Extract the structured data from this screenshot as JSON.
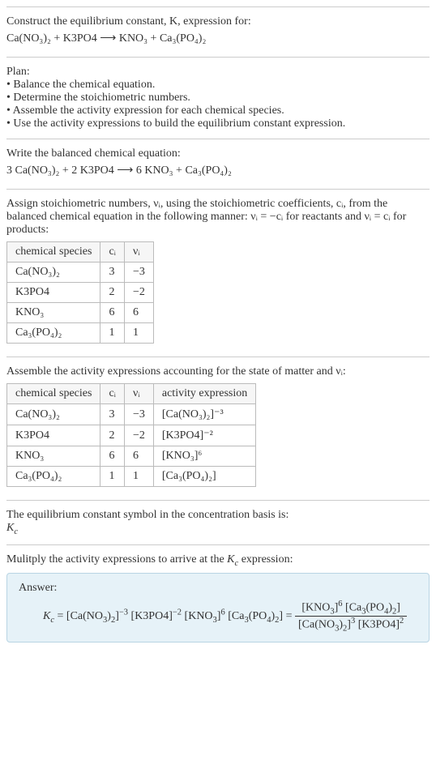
{
  "intro": {
    "line1": "Construct the equilibrium constant, K, expression for:",
    "equation": "Ca(NO₃)₂ + K3PO4 ⟶ KNO₃ + Ca₃(PO₄)₂"
  },
  "plan": {
    "heading": "Plan:",
    "items": [
      "• Balance the chemical equation.",
      "• Determine the stoichiometric numbers.",
      "• Assemble the activity expression for each chemical species.",
      "• Use the activity expressions to build the equilibrium constant expression."
    ]
  },
  "balanced": {
    "heading": "Write the balanced chemical equation:",
    "equation": "3 Ca(NO₃)₂ + 2 K3PO4 ⟶ 6 KNO₃ + Ca₃(PO₄)₂"
  },
  "stoich": {
    "text": "Assign stoichiometric numbers, νᵢ, using the stoichiometric coefficients, cᵢ, from the balanced chemical equation in the following manner: νᵢ = −cᵢ for reactants and νᵢ = cᵢ for products:",
    "headers": [
      "chemical species",
      "cᵢ",
      "νᵢ"
    ],
    "rows": [
      [
        "Ca(NO₃)₂",
        "3",
        "−3"
      ],
      [
        "K3PO4",
        "2",
        "−2"
      ],
      [
        "KNO₃",
        "6",
        "6"
      ],
      [
        "Ca₃(PO₄)₂",
        "1",
        "1"
      ]
    ]
  },
  "activity": {
    "heading": "Assemble the activity expressions accounting for the state of matter and νᵢ:",
    "headers": [
      "chemical species",
      "cᵢ",
      "νᵢ",
      "activity expression"
    ],
    "rows": [
      [
        "Ca(NO₃)₂",
        "3",
        "−3",
        "[Ca(NO₃)₂]⁻³"
      ],
      [
        "K3PO4",
        "2",
        "−2",
        "[K3PO4]⁻²"
      ],
      [
        "KNO₃",
        "6",
        "6",
        "[KNO₃]⁶"
      ],
      [
        "Ca₃(PO₄)₂",
        "1",
        "1",
        "[Ca₃(PO₄)₂]"
      ]
    ]
  },
  "symbol": {
    "line1": "The equilibrium constant symbol in the concentration basis is:",
    "line2": "K_c"
  },
  "multiply": {
    "heading": "Mulitply the activity expressions to arrive at the K_c expression:"
  },
  "answer": {
    "label": "Answer:",
    "lhs": "K_c = [Ca(NO₃)₂]⁻³ [K3PO4]⁻² [KNO₃]⁶ [Ca₃(PO₄)₂] =",
    "num": "[KNO₃]⁶ [Ca₃(PO₄)₂]",
    "den": "[Ca(NO₃)₂]³ [K3PO4]²"
  }
}
